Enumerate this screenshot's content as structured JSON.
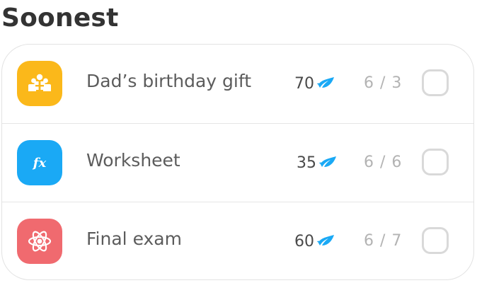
{
  "section": {
    "title": "Soonest"
  },
  "tasks": [
    {
      "title": "Dad’s birthday gift",
      "points": "70",
      "date": "6 / 3",
      "icon": "gift-people-icon",
      "color": "#FBB81A",
      "checked": false
    },
    {
      "title": "Worksheet",
      "points": "35",
      "date": "6 / 6",
      "icon": "fx-function-icon",
      "color": "#1AA9F5",
      "checked": false
    },
    {
      "title": "Final exam",
      "points": "60",
      "date": "6 / 7",
      "icon": "atom-icon",
      "color": "#F06A6F",
      "checked": false
    }
  ],
  "colors": {
    "leaf": "#1AA9F5",
    "checkbox_border": "#d9d9d9",
    "date_text": "#b3b3b3"
  }
}
